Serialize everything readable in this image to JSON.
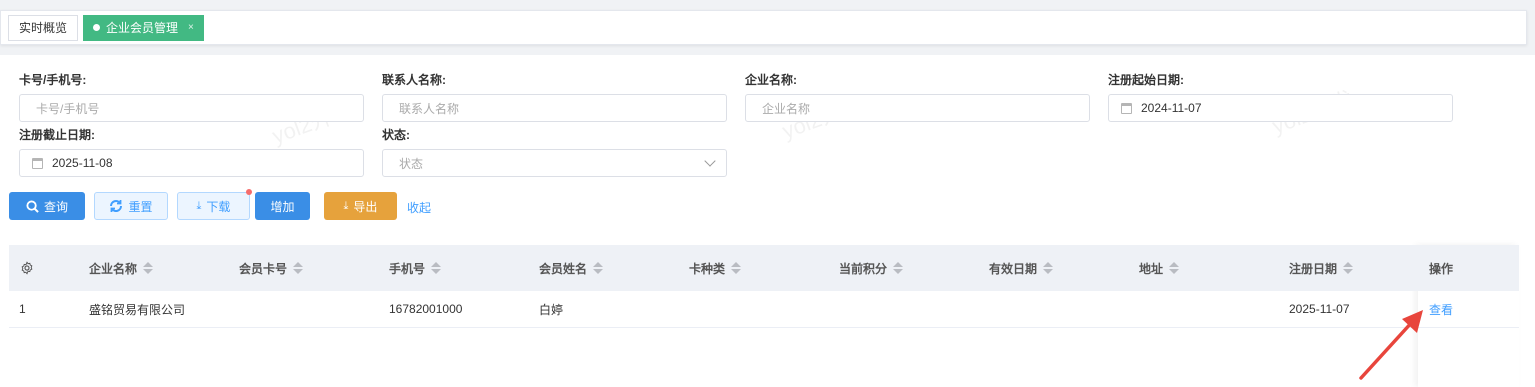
{
  "tabs": [
    {
      "label": "实时概览",
      "active": false
    },
    {
      "label": "企业会员管理",
      "active": true,
      "close": "×"
    }
  ],
  "form": {
    "card_phone": {
      "label": "卡号/手机号:",
      "placeholder": "卡号/手机号"
    },
    "contact_name": {
      "label": "联系人名称:",
      "placeholder": "联系人名称"
    },
    "company_name": {
      "label": "企业名称:",
      "placeholder": "企业名称"
    },
    "reg_start": {
      "label": "注册起始日期:",
      "value": "2024-11-07"
    },
    "reg_end": {
      "label": "注册截止日期:",
      "value": "2025-11-08"
    },
    "status": {
      "label": "状态:",
      "placeholder": "状态"
    }
  },
  "buttons": {
    "query": "查询",
    "reset": "重置",
    "download": "下载",
    "add": "增加",
    "export": "导出",
    "collapse": "收起"
  },
  "table": {
    "columns": [
      "企业名称",
      "会员卡号",
      "手机号",
      "会员姓名",
      "卡种类",
      "当前积分",
      "有效日期",
      "地址",
      "注册日期",
      "操作"
    ],
    "rows": [
      {
        "index": "1",
        "company": "盛铭贸易有限公司",
        "card_no": "",
        "phone": "16782001000",
        "member_name": "白婷",
        "card_type": "",
        "points": "",
        "valid_date": "",
        "address": "",
        "reg_date": "2025-11-07",
        "action": "查看"
      }
    ]
  },
  "watermark": "yol2开发",
  "colors": {
    "accent": "#3a8ee6",
    "active_tab": "#42b983",
    "export": "#e6a23c",
    "link": "#409eff",
    "annotation_arrow": "#e8453c"
  }
}
